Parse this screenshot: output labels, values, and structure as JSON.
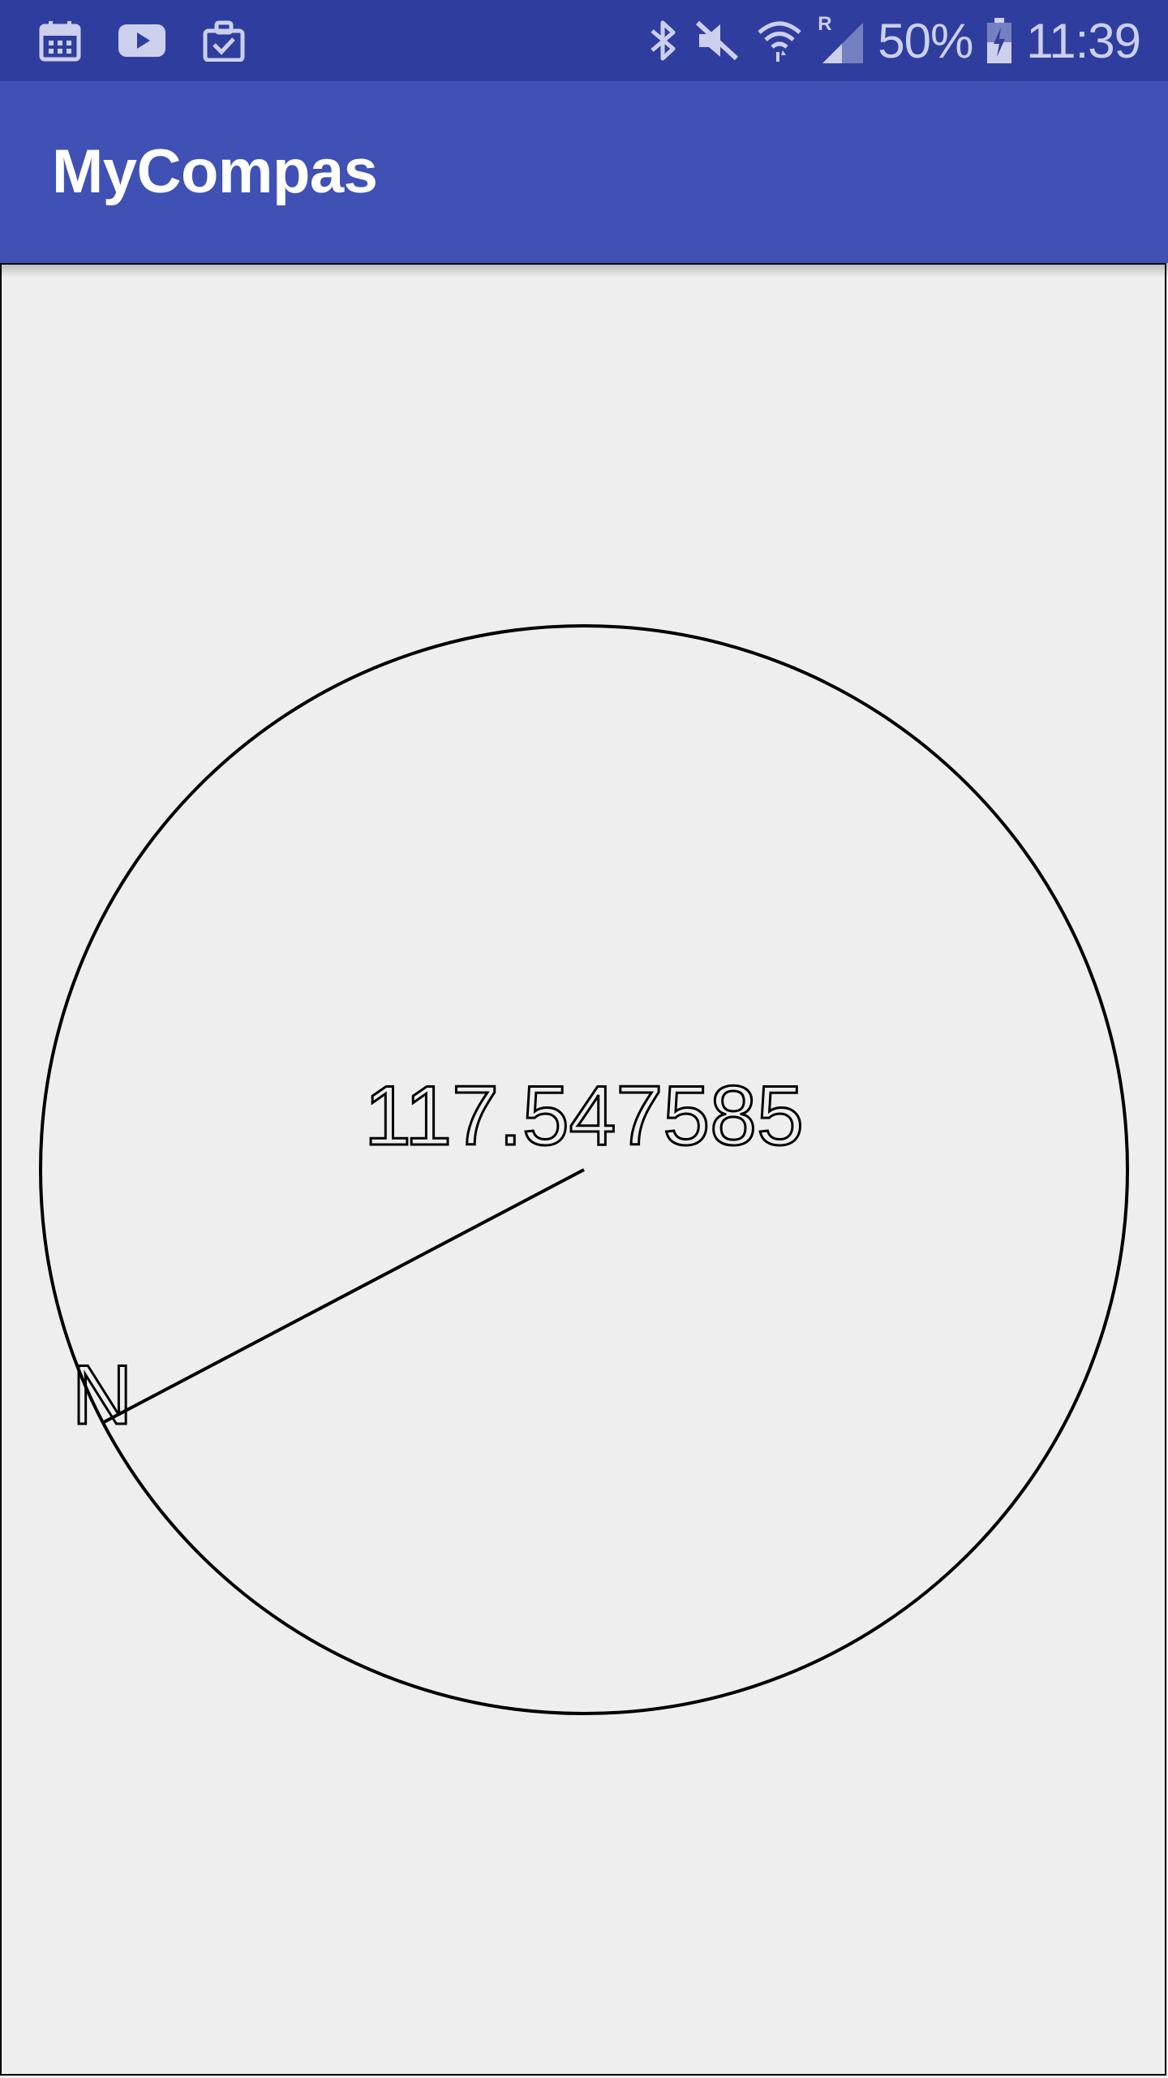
{
  "status_bar": {
    "left_icons": [
      "calendar-icon",
      "youtube-icon",
      "clipboard-check-icon"
    ],
    "right_icons": [
      "bluetooth-icon",
      "mute-icon",
      "wifi-icon",
      "signal-roaming-icon",
      "battery-charging-icon"
    ],
    "roaming_label": "R",
    "battery": "50%",
    "time": "11:39"
  },
  "app_bar": {
    "title": "MyCompas"
  },
  "compass": {
    "heading_value": "117.547585",
    "north_label": "N",
    "heading_degrees": 117.547585
  },
  "colors": {
    "status_bar": "#2f3e9e",
    "app_bar": "#3f51b5",
    "background": "#eeeeee",
    "stroke": "#000000"
  }
}
